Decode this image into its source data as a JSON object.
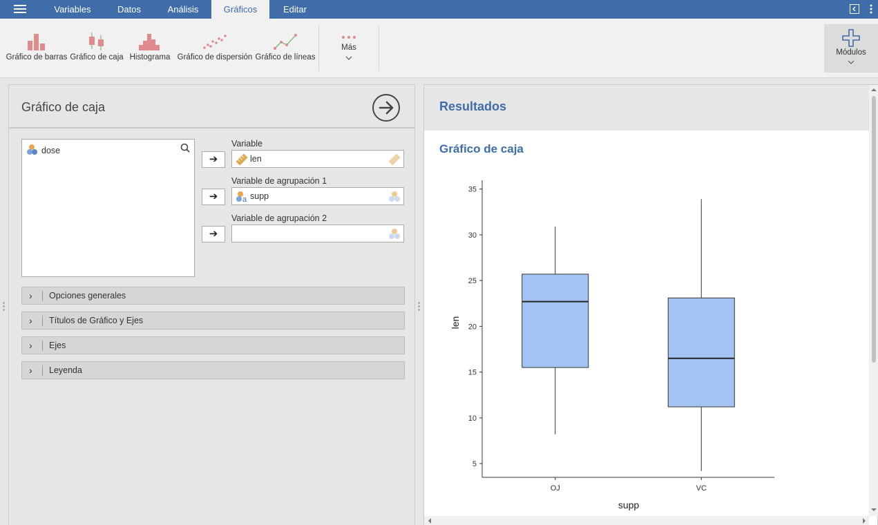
{
  "menu": {
    "tabs": [
      {
        "label": "Variables"
      },
      {
        "label": "Datos"
      },
      {
        "label": "Análisis"
      },
      {
        "label": "Gráficos"
      },
      {
        "label": "Editar"
      }
    ]
  },
  "ribbon": {
    "buttons": [
      {
        "label": "Gráfico de barras",
        "icon": "bar-chart-icon"
      },
      {
        "label": "Gráfico de caja",
        "icon": "box-plot-icon"
      },
      {
        "label": "Histograma",
        "icon": "histogram-icon"
      },
      {
        "label": "Gráfico de dispersión",
        "icon": "scatter-icon"
      },
      {
        "label": "Gráfico de líneas",
        "icon": "line-chart-icon"
      }
    ],
    "more_label": "Más",
    "modules_label": "Módulos"
  },
  "options": {
    "title": "Gráfico de caja",
    "available_vars": [
      {
        "name": "dose",
        "type": "nominal"
      }
    ],
    "targets": [
      {
        "label": "Variable",
        "value": "len"
      },
      {
        "label": "Variable de agrupación 1",
        "value": "supp"
      },
      {
        "label": "Variable de agrupación 2",
        "value": ""
      }
    ],
    "sections": [
      "Opciones generales",
      "Títulos de Gráfico y Ejes",
      "Ejes",
      "Leyenda"
    ]
  },
  "results": {
    "title": "Resultados",
    "subtitle": "Gráfico de caja"
  },
  "colors": {
    "topbar": "#3e6da9",
    "heading": "#3e6da9",
    "box_fill": "#a3c4f2"
  },
  "chart_data": {
    "type": "box",
    "xlabel": "supp",
    "ylabel": "len",
    "ylim": [
      3.5,
      35.5
    ],
    "yticks": [
      5,
      10,
      15,
      20,
      25,
      30,
      35
    ],
    "categories": [
      "OJ",
      "VC"
    ],
    "boxes": [
      {
        "name": "OJ",
        "min": 8.2,
        "q1": 15.5,
        "median": 22.7,
        "q3": 25.7,
        "max": 30.9
      },
      {
        "name": "VC",
        "min": 4.2,
        "q1": 11.2,
        "median": 16.5,
        "q3": 23.1,
        "max": 33.9
      }
    ],
    "grid": false,
    "legend": "none"
  }
}
